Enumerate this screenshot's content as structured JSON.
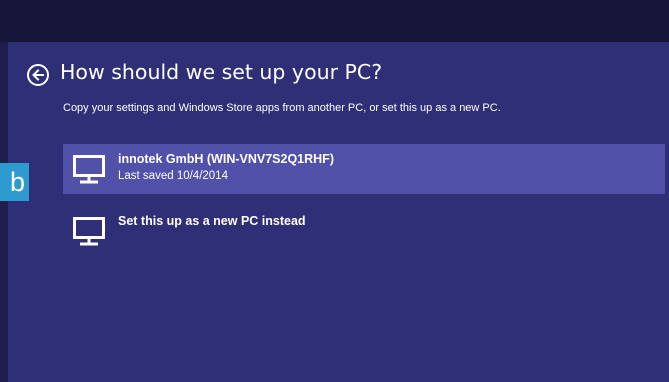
{
  "colors": {
    "background": "#2f2f77",
    "top_bar": "#161638",
    "selected_item": "#5151aa",
    "step_tab": "#2e9bd0",
    "text": "#ffffff"
  },
  "header": {
    "back_icon": "back-arrow-circle-icon",
    "title": "How should we set up your PC?",
    "subtitle": "Copy your settings and Windows Store apps from another PC, or set this up as a new PC."
  },
  "options": [
    {
      "icon": "pc-monitor-icon",
      "title": "innotek GmbH (WIN-VNV7S2Q1RHF)",
      "subtitle": "Last saved 10/4/2014",
      "selected": true
    },
    {
      "icon": "pc-monitor-icon",
      "title": "Set this up as a new PC instead",
      "selected": false
    }
  ],
  "step_label": "b"
}
